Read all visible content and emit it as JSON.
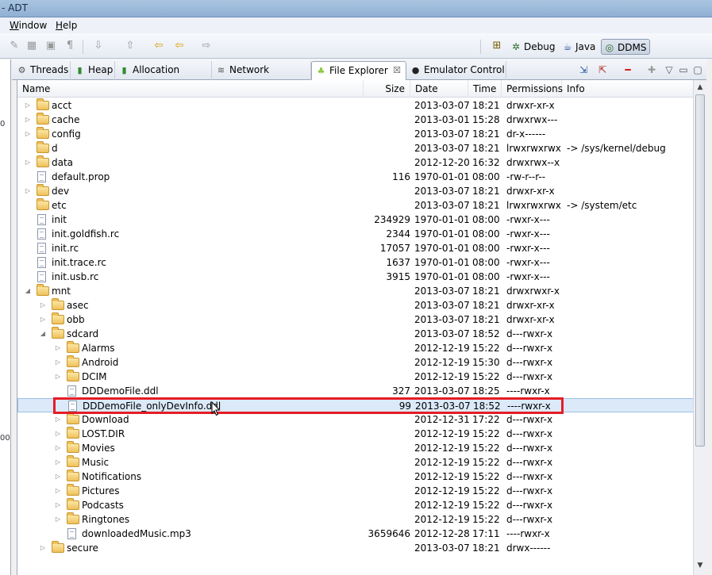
{
  "window": {
    "title": "- ADT"
  },
  "menu": [
    {
      "label": "Window",
      "underline": "W",
      "rest": "indow"
    },
    {
      "label": "Help",
      "underline": "H",
      "rest": "elp"
    }
  ],
  "perspectives": [
    {
      "label": "Debug",
      "icon": "debug-icon"
    },
    {
      "label": "Java",
      "icon": "java-icon"
    },
    {
      "label": "DDMS",
      "icon": "ddms-icon",
      "active": true
    }
  ],
  "tabs": [
    {
      "label": "Threads",
      "icon": "threads-icon"
    },
    {
      "label": "Heap",
      "icon": "heap-icon"
    },
    {
      "label": "Allocation Tracker",
      "icon": "allocation-icon"
    },
    {
      "label": "Network Statistics",
      "icon": "network-icon"
    },
    {
      "label": "File Explorer",
      "icon": "android-icon",
      "active": true,
      "close": "☒"
    },
    {
      "label": "Emulator Control",
      "icon": "emulator-icon"
    }
  ],
  "columns": {
    "name": "Name",
    "size": "Size",
    "date": "Date",
    "time": "Time",
    "permissions": "Permissions",
    "info": "Info"
  },
  "left_pane": {
    "text1": "0",
    "text2": "00"
  },
  "rows": [
    {
      "name": "acct",
      "type": "folder",
      "level": 0,
      "exp": "collapsed",
      "size": "",
      "date": "2013-03-07",
      "time": "18:21",
      "perm": "drwxr-xr-x",
      "info": ""
    },
    {
      "name": "cache",
      "type": "folder",
      "level": 0,
      "exp": "collapsed",
      "size": "",
      "date": "2013-03-01",
      "time": "15:28",
      "perm": "drwxrwx---",
      "info": ""
    },
    {
      "name": "config",
      "type": "folder",
      "level": 0,
      "exp": "collapsed",
      "size": "",
      "date": "2013-03-07",
      "time": "18:21",
      "perm": "dr-x------",
      "info": ""
    },
    {
      "name": "d",
      "type": "folder",
      "level": 0,
      "exp": "none",
      "size": "",
      "date": "2013-03-07",
      "time": "18:21",
      "perm": "lrwxrwxrwx",
      "info": "-> /sys/kernel/debug"
    },
    {
      "name": "data",
      "type": "folder",
      "level": 0,
      "exp": "collapsed",
      "size": "",
      "date": "2012-12-20",
      "time": "16:32",
      "perm": "drwxrwx--x",
      "info": ""
    },
    {
      "name": "default.prop",
      "type": "file",
      "level": 0,
      "exp": "none",
      "size": "116",
      "date": "1970-01-01",
      "time": "08:00",
      "perm": "-rw-r--r--",
      "info": ""
    },
    {
      "name": "dev",
      "type": "folder",
      "level": 0,
      "exp": "collapsed",
      "size": "",
      "date": "2013-03-07",
      "time": "18:21",
      "perm": "drwxr-xr-x",
      "info": ""
    },
    {
      "name": "etc",
      "type": "folder",
      "level": 0,
      "exp": "none",
      "size": "",
      "date": "2013-03-07",
      "time": "18:21",
      "perm": "lrwxrwxrwx",
      "info": "-> /system/etc"
    },
    {
      "name": "init",
      "type": "file",
      "level": 0,
      "exp": "none",
      "size": "234929",
      "date": "1970-01-01",
      "time": "08:00",
      "perm": "-rwxr-x---",
      "info": ""
    },
    {
      "name": "init.goldfish.rc",
      "type": "file",
      "level": 0,
      "exp": "none",
      "size": "2344",
      "date": "1970-01-01",
      "time": "08:00",
      "perm": "-rwxr-x---",
      "info": ""
    },
    {
      "name": "init.rc",
      "type": "file",
      "level": 0,
      "exp": "none",
      "size": "17057",
      "date": "1970-01-01",
      "time": "08:00",
      "perm": "-rwxr-x---",
      "info": ""
    },
    {
      "name": "init.trace.rc",
      "type": "file",
      "level": 0,
      "exp": "none",
      "size": "1637",
      "date": "1970-01-01",
      "time": "08:00",
      "perm": "-rwxr-x---",
      "info": ""
    },
    {
      "name": "init.usb.rc",
      "type": "file",
      "level": 0,
      "exp": "none",
      "size": "3915",
      "date": "1970-01-01",
      "time": "08:00",
      "perm": "-rwxr-x---",
      "info": ""
    },
    {
      "name": "mnt",
      "type": "folder",
      "level": 0,
      "exp": "expanded",
      "size": "",
      "date": "2013-03-07",
      "time": "18:21",
      "perm": "drwxrwxr-x",
      "info": ""
    },
    {
      "name": "asec",
      "type": "folder",
      "level": 1,
      "exp": "collapsed",
      "size": "",
      "date": "2013-03-07",
      "time": "18:21",
      "perm": "drwxr-xr-x",
      "info": ""
    },
    {
      "name": "obb",
      "type": "folder",
      "level": 1,
      "exp": "collapsed",
      "size": "",
      "date": "2013-03-07",
      "time": "18:21",
      "perm": "drwxr-xr-x",
      "info": ""
    },
    {
      "name": "sdcard",
      "type": "folder",
      "level": 1,
      "exp": "expanded",
      "size": "",
      "date": "2013-03-07",
      "time": "18:52",
      "perm": "d---rwxr-x",
      "info": ""
    },
    {
      "name": "Alarms",
      "type": "folder",
      "level": 2,
      "exp": "collapsed",
      "size": "",
      "date": "2012-12-19",
      "time": "15:22",
      "perm": "d---rwxr-x",
      "info": ""
    },
    {
      "name": "Android",
      "type": "folder",
      "level": 2,
      "exp": "collapsed",
      "size": "",
      "date": "2012-12-19",
      "time": "15:30",
      "perm": "d---rwxr-x",
      "info": ""
    },
    {
      "name": "DCIM",
      "type": "folder",
      "level": 2,
      "exp": "collapsed",
      "size": "",
      "date": "2012-12-19",
      "time": "15:22",
      "perm": "d---rwxr-x",
      "info": ""
    },
    {
      "name": "DDDemoFile.ddl",
      "type": "file",
      "level": 2,
      "exp": "none",
      "size": "327",
      "date": "2013-03-07",
      "time": "18:25",
      "perm": "----rwxr-x",
      "info": ""
    },
    {
      "name": "DDDemoFile_onlyDevInfo.ddl",
      "type": "file",
      "level": 2,
      "exp": "none",
      "size": "99",
      "date": "2013-03-07",
      "time": "18:52",
      "perm": "----rwxr-x",
      "info": "",
      "selected": true
    },
    {
      "name": "Download",
      "type": "folder",
      "level": 2,
      "exp": "collapsed",
      "size": "",
      "date": "2012-12-31",
      "time": "17:22",
      "perm": "d---rwxr-x",
      "info": ""
    },
    {
      "name": "LOST.DIR",
      "type": "folder",
      "level": 2,
      "exp": "collapsed",
      "size": "",
      "date": "2012-12-19",
      "time": "15:22",
      "perm": "d---rwxr-x",
      "info": ""
    },
    {
      "name": "Movies",
      "type": "folder",
      "level": 2,
      "exp": "collapsed",
      "size": "",
      "date": "2012-12-19",
      "time": "15:22",
      "perm": "d---rwxr-x",
      "info": ""
    },
    {
      "name": "Music",
      "type": "folder",
      "level": 2,
      "exp": "collapsed",
      "size": "",
      "date": "2012-12-19",
      "time": "15:22",
      "perm": "d---rwxr-x",
      "info": ""
    },
    {
      "name": "Notifications",
      "type": "folder",
      "level": 2,
      "exp": "collapsed",
      "size": "",
      "date": "2012-12-19",
      "time": "15:22",
      "perm": "d---rwxr-x",
      "info": ""
    },
    {
      "name": "Pictures",
      "type": "folder",
      "level": 2,
      "exp": "collapsed",
      "size": "",
      "date": "2012-12-19",
      "time": "15:22",
      "perm": "d---rwxr-x",
      "info": ""
    },
    {
      "name": "Podcasts",
      "type": "folder",
      "level": 2,
      "exp": "collapsed",
      "size": "",
      "date": "2012-12-19",
      "time": "15:22",
      "perm": "d---rwxr-x",
      "info": ""
    },
    {
      "name": "Ringtones",
      "type": "folder",
      "level": 2,
      "exp": "collapsed",
      "size": "",
      "date": "2012-12-19",
      "time": "15:22",
      "perm": "d---rwxr-x",
      "info": ""
    },
    {
      "name": "downloadedMusic.mp3",
      "type": "file",
      "level": 2,
      "exp": "none",
      "size": "3659646",
      "date": "2012-12-28",
      "time": "17:11",
      "perm": "----rwxr-x",
      "info": ""
    },
    {
      "name": "secure",
      "type": "folder",
      "level": 1,
      "exp": "collapsed",
      "size": "",
      "date": "2013-03-07",
      "time": "18:21",
      "perm": "drwx------",
      "info": ""
    }
  ],
  "colors": {
    "highlight": "#e41d26",
    "selection": "#dbe9f8"
  }
}
